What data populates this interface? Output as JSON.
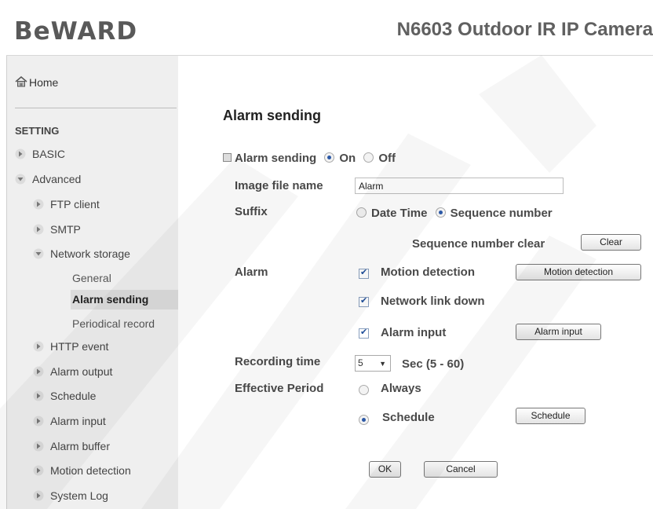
{
  "header": {
    "logo": "BeWARD",
    "model": "N6603 Outdoor IR IP Camera"
  },
  "sidebar": {
    "home": "Home",
    "setting": "SETTING",
    "items": [
      {
        "label": "BASIC",
        "state": "collapsed"
      },
      {
        "label": "Advanced",
        "state": "expanded"
      },
      {
        "label": "FTP client",
        "state": "collapsed"
      },
      {
        "label": "SMTP",
        "state": "collapsed"
      },
      {
        "label": "Network storage",
        "state": "expanded"
      },
      {
        "label": "HTTP event",
        "state": "collapsed"
      },
      {
        "label": "Alarm output",
        "state": "collapsed"
      },
      {
        "label": "Schedule",
        "state": "collapsed"
      },
      {
        "label": "Alarm input",
        "state": "collapsed"
      },
      {
        "label": "Alarm buffer",
        "state": "collapsed"
      },
      {
        "label": "Motion detection",
        "state": "collapsed"
      },
      {
        "label": "System Log",
        "state": "collapsed"
      }
    ],
    "network_storage_sub": [
      "General",
      "Alarm sending",
      "Periodical record"
    ],
    "active_sub": "Alarm sending"
  },
  "main": {
    "title": "Alarm sending",
    "alarm_sending": {
      "label": "Alarm sending",
      "on": "On",
      "off": "Off",
      "selected": "On"
    },
    "image_file_name": {
      "label": "Image file name",
      "value": "Alarm"
    },
    "suffix": {
      "label": "Suffix",
      "date_time": "Date Time",
      "sequence": "Sequence number",
      "selected": "Sequence number"
    },
    "sequence_clear": {
      "label": "Sequence number clear",
      "button": "Clear"
    },
    "alarm": {
      "label": "Alarm",
      "motion": {
        "label": "Motion detection",
        "checked": true,
        "button": "Motion detection"
      },
      "network": {
        "label": "Network link down",
        "checked": true
      },
      "input": {
        "label": "Alarm input",
        "checked": true,
        "button": "Alarm input"
      }
    },
    "recording_time": {
      "label": "Recording time",
      "value": "5",
      "unit": "Sec (5 - 60)"
    },
    "effective_period": {
      "label": "Effective Period",
      "always": "Always",
      "schedule": "Schedule",
      "selected": "Schedule",
      "button": "Schedule"
    },
    "ok": "OK",
    "cancel": "Cancel"
  },
  "colors": {
    "sidebar_bg": "#efefef",
    "active_bg": "#dcdcdc",
    "text": "#4a4a4a",
    "radio_dot": "#2b58a6"
  }
}
